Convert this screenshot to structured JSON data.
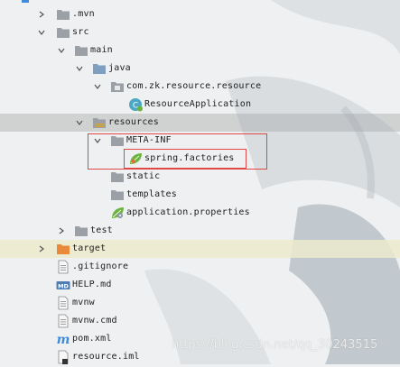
{
  "tree": {
    "mvn": ".mvn",
    "src": "src",
    "main": "main",
    "java": "java",
    "package": "com.zk.resource.resource",
    "app_class": "ResourceApplication",
    "resources": "resources",
    "meta_inf": "META-INF",
    "spring_factories": "spring.factories",
    "static": "static",
    "templates": "templates",
    "app_properties": "application.properties",
    "test": "test",
    "target": "target",
    "gitignore": ".gitignore",
    "help_md": "HELP.md",
    "mvnw": "mvnw",
    "mvnw_cmd": "mvnw.cmd",
    "pom": "pom.xml",
    "iml": "resource.iml"
  },
  "icons": {
    "md_badge": "MD",
    "maven_m": "m"
  },
  "watermark": "https://blog.csdn.net/qq_30243515",
  "colors": {
    "folder_gray": "#9aa0a6",
    "folder_orange": "#e98a3a",
    "resource_yellow": "#d9a528",
    "spring_green": "#6db33f",
    "highlight_box": "#e04848",
    "selection": "#a0a0a0"
  }
}
